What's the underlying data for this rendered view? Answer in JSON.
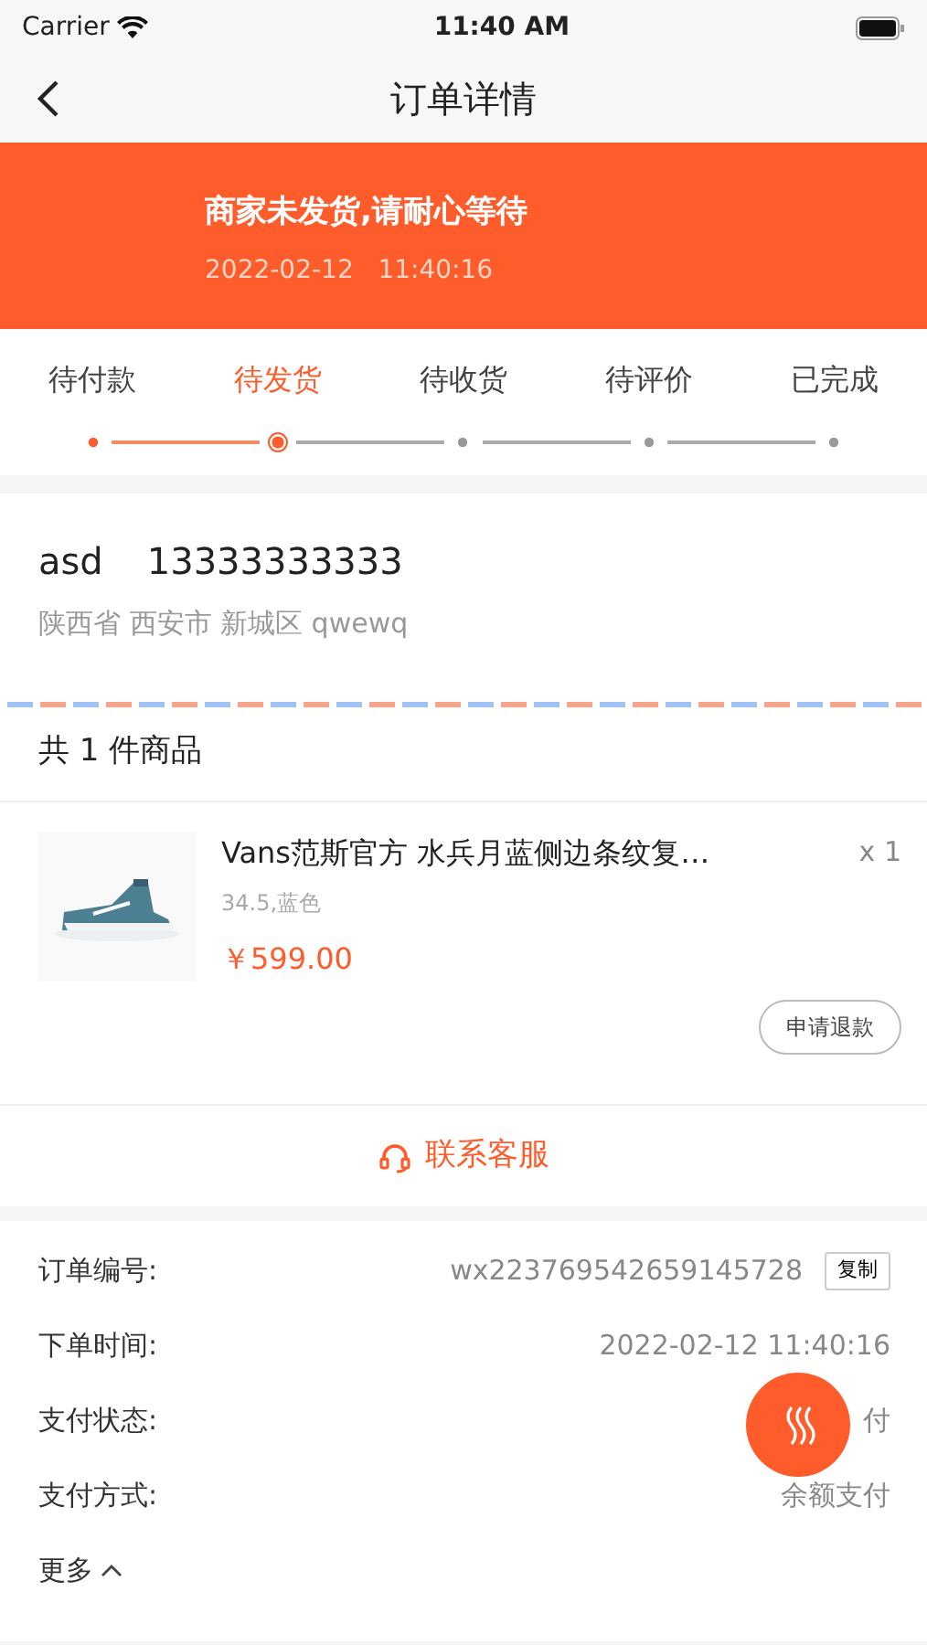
{
  "status_bar": {
    "carrier": "Carrier",
    "time": "11:40 AM"
  },
  "nav": {
    "title": "订单详情"
  },
  "banner": {
    "message": "商家未发货,请耐心等待",
    "time": "2022-02-12   11:40:16"
  },
  "steps": [
    {
      "label": "待付款",
      "done": true,
      "selected": false
    },
    {
      "label": "待发货",
      "done": false,
      "selected": true
    },
    {
      "label": "待收货",
      "done": false,
      "selected": false
    },
    {
      "label": "待评价",
      "done": false,
      "selected": false
    },
    {
      "label": "已完成",
      "done": false,
      "selected": false
    }
  ],
  "address": {
    "name": "asd",
    "phone": "13333333333",
    "detail": "陕西省 西安市 新城区 qwewq"
  },
  "goods": {
    "count_label": "共 1 件商品",
    "items": [
      {
        "title": "Vans范斯官方 水兵月蓝侧边条纹复…",
        "spec": "34.5,蓝色",
        "price": "￥599.00",
        "quantity": "x 1",
        "action": "申请退款"
      }
    ]
  },
  "contact": {
    "label": "联系客服"
  },
  "order_info": [
    {
      "label": "订单编号:",
      "value": "wx223769542659145728",
      "action": "复制"
    },
    {
      "label": "下单时间:",
      "value": "2022-02-12 11:40:16"
    },
    {
      "label": "支付状态:",
      "value": "付"
    },
    {
      "label": "支付方式:",
      "value": "余额支付"
    }
  ],
  "more": {
    "label": "更多"
  }
}
